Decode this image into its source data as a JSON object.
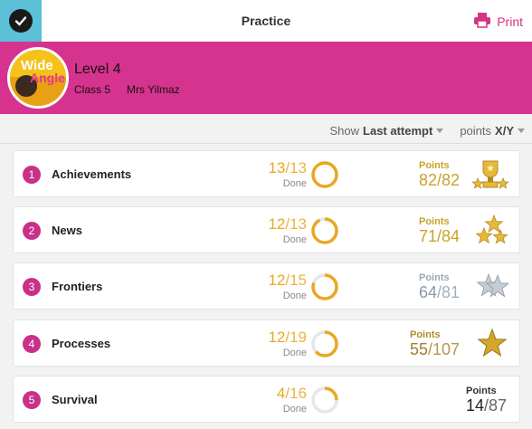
{
  "header": {
    "title": "Practice",
    "print_label": "Print"
  },
  "course": {
    "logo_text_1": "Wide",
    "logo_text_2": "Angle",
    "level": "Level 4",
    "class_name": "Class 5",
    "teacher": "Mrs Yilmaz"
  },
  "filters": {
    "show_prefix": "Show",
    "show_value": "Last attempt",
    "points_prefix": "points",
    "points_value": "X/Y"
  },
  "colors": {
    "accent": "#d6338f",
    "check_bg": "#5bc0d8",
    "done": "#e9a722",
    "gold": "#c9a227",
    "silver": "#9aa7b4"
  },
  "units": [
    {
      "number": "1",
      "name": "Achievements",
      "done": "13",
      "total": "/13",
      "done_label": "Done",
      "progress": 1.0,
      "points_label": "Points",
      "points": "82",
      "points_total": "/82",
      "award": "trophy-icon",
      "tier": "gold"
    },
    {
      "number": "2",
      "name": "News",
      "done": "12",
      "total": "/13",
      "done_label": "Done",
      "progress": 0.923,
      "points_label": "Points",
      "points": "71",
      "points_total": "/84",
      "award": "three-stars-icon",
      "tier": "gold"
    },
    {
      "number": "3",
      "name": "Frontiers",
      "done": "12",
      "total": "/15",
      "done_label": "Done",
      "progress": 0.8,
      "points_label": "Points",
      "points": "64",
      "points_total": "/81",
      "award": "two-stars-icon",
      "tier": "silver"
    },
    {
      "number": "4",
      "name": "Processes",
      "done": "12",
      "total": "/19",
      "done_label": "Done",
      "progress": 0.632,
      "points_label": "Points",
      "points": "55",
      "points_total": "/107",
      "award": "star-icon",
      "tier": "bronze"
    },
    {
      "number": "5",
      "name": "Survival",
      "done": "4",
      "total": "/16",
      "done_label": "Done",
      "progress": 0.25,
      "points_label": "Points",
      "points": "14",
      "points_total": "/87",
      "award": "",
      "tier": "none"
    }
  ]
}
